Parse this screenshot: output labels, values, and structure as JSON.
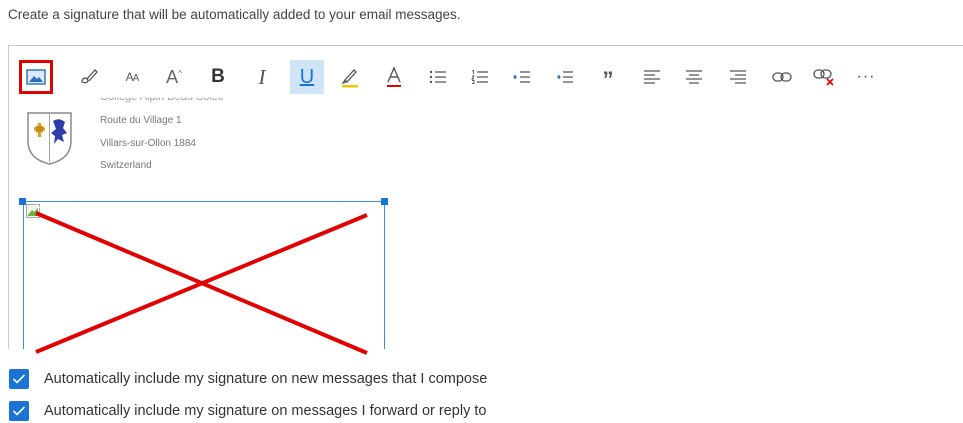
{
  "description": "Create a signature that will be automatically added to your email messages.",
  "toolbar": {
    "buttons": [
      {
        "name": "insert-image",
        "icon": "image-icon"
      },
      {
        "name": "format-painter",
        "icon": "brush-icon"
      },
      {
        "name": "font",
        "icon": "font-size-icon",
        "glyph": "AA"
      },
      {
        "name": "font-size",
        "icon": "increase-font-icon",
        "glyph": "A"
      },
      {
        "name": "bold",
        "icon": "bold-icon",
        "glyph": "B"
      },
      {
        "name": "italic",
        "icon": "italic-icon",
        "glyph": "I"
      },
      {
        "name": "underline",
        "icon": "underline-icon",
        "glyph": "U"
      },
      {
        "name": "highlight",
        "icon": "highlighter-icon"
      },
      {
        "name": "font-color",
        "icon": "font-color-icon",
        "glyph": "A"
      },
      {
        "name": "bullets",
        "icon": "bulleted-list-icon"
      },
      {
        "name": "numbering",
        "icon": "numbered-list-icon"
      },
      {
        "name": "decrease-indent",
        "icon": "outdent-icon"
      },
      {
        "name": "increase-indent",
        "icon": "indent-icon"
      },
      {
        "name": "quote",
        "icon": "quote-icon",
        "glyph": "”"
      },
      {
        "name": "align-left",
        "icon": "align-left-icon"
      },
      {
        "name": "align-center",
        "icon": "align-center-icon"
      },
      {
        "name": "align-right",
        "icon": "align-right-icon"
      },
      {
        "name": "insert-link",
        "icon": "link-icon"
      },
      {
        "name": "remove-link",
        "icon": "unlink-icon"
      },
      {
        "name": "more",
        "icon": "more-icon",
        "glyph": "···"
      }
    ],
    "active_button": "underline",
    "highlighted_button": "insert-image",
    "highlight_color": "#e00000",
    "underline_glyph_color": "#1b74d5",
    "font_color_glyph_color": "#e00000",
    "highlighter_color": "#f2c500"
  },
  "signature": {
    "address_lines": [
      "Route du Village 1",
      "Villars-sur-Ollon 1884",
      "Switzerland"
    ],
    "cut_off_line": "College Alpin Beau Soleil"
  },
  "annotation": {
    "color": "#e00000"
  },
  "options": [
    {
      "label": "Automatically include my signature on new messages that I compose",
      "checked": true
    },
    {
      "label": "Automatically include my signature on messages I forward or reply to",
      "checked": true
    }
  ],
  "colors": {
    "accent": "#1b74d5",
    "active_bg": "#cfe4f7"
  }
}
